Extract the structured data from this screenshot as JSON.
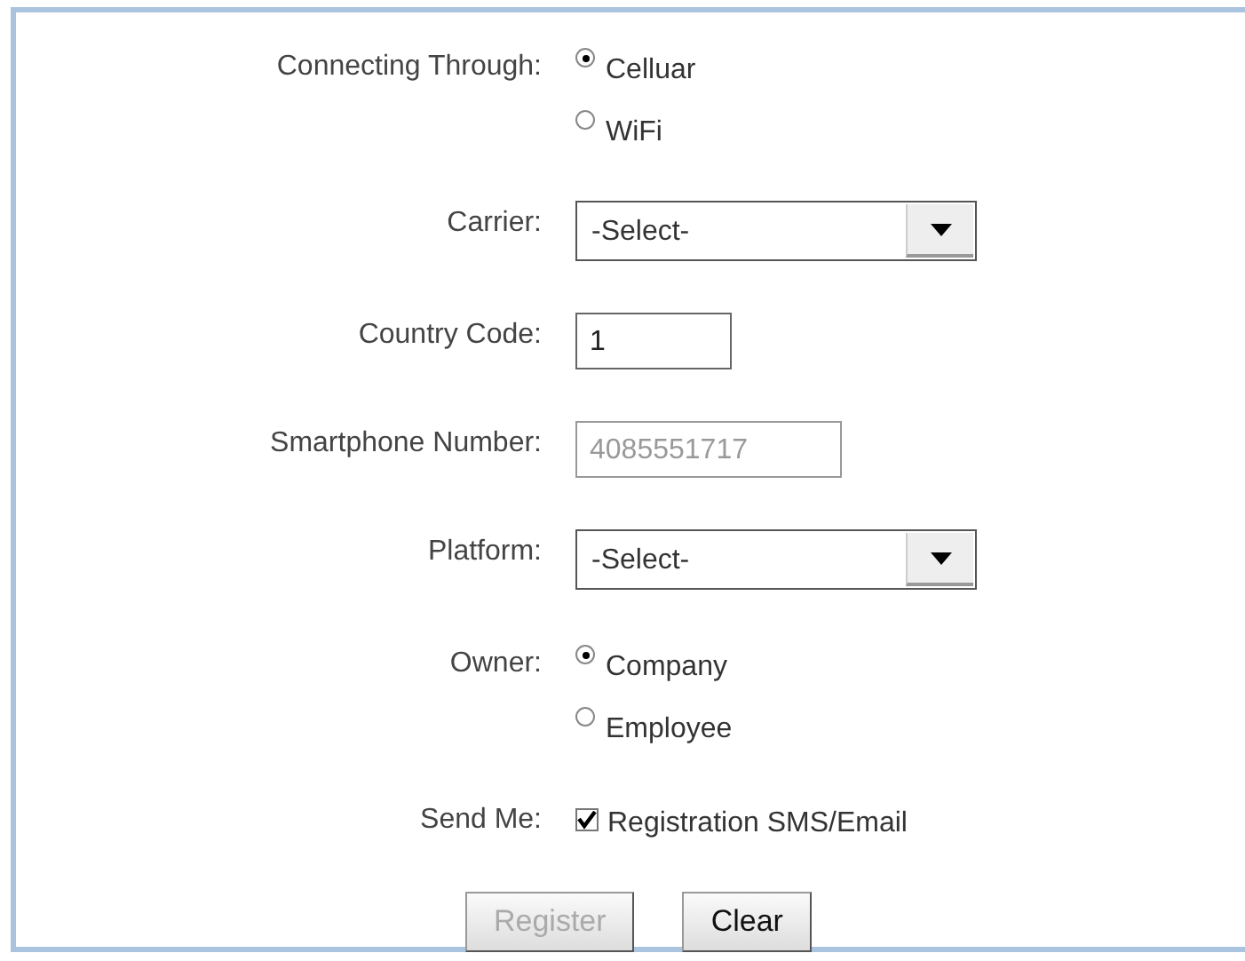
{
  "fields": [
    {
      "kind": "radio",
      "label": "Connecting Through:",
      "options": [
        {
          "label": "Celluar",
          "selected": true
        },
        {
          "label": "WiFi",
          "selected": false
        }
      ]
    },
    {
      "kind": "select",
      "label": "Carrier:",
      "value": "-Select-"
    },
    {
      "kind": "text",
      "label": "Country Code:",
      "value": "1",
      "disabled": false
    },
    {
      "kind": "text",
      "label": "Smartphone Number:",
      "value": "4085551717",
      "disabled": true
    },
    {
      "kind": "select",
      "label": "Platform:",
      "value": "-Select-"
    },
    {
      "kind": "radio",
      "label": "Owner:",
      "options": [
        {
          "label": "Company",
          "selected": true
        },
        {
          "label": "Employee",
          "selected": false
        }
      ]
    },
    {
      "kind": "checkbox",
      "label": "Send Me:",
      "text": "Registration SMS/Email",
      "checked": true
    }
  ],
  "buttons": [
    {
      "label": "Register",
      "disabled": true
    },
    {
      "label": "Clear",
      "disabled": false
    }
  ]
}
